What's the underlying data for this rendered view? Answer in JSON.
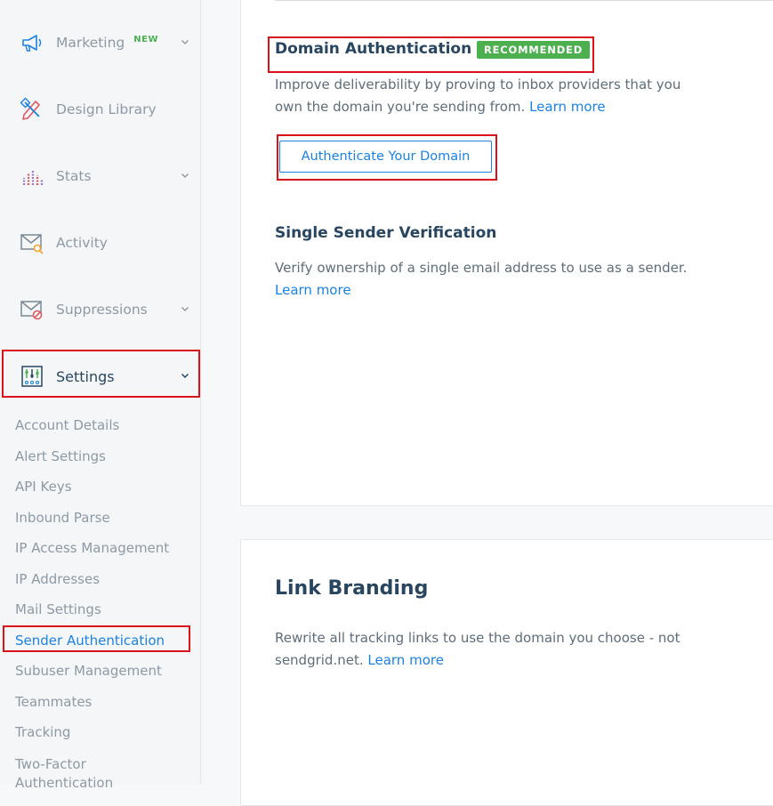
{
  "sidebar": {
    "items": [
      {
        "label": "Marketing",
        "badge": "NEW",
        "icon": "megaphone-icon"
      },
      {
        "label": "Design Library",
        "icon": "design-tools-icon"
      },
      {
        "label": "Stats",
        "icon": "bar-chart-icon"
      },
      {
        "label": "Activity",
        "icon": "envelope-search-icon"
      },
      {
        "label": "Suppressions",
        "icon": "envelope-blocked-icon"
      },
      {
        "label": "Settings",
        "icon": "sliders-icon"
      }
    ],
    "settings_sub": [
      "Account Details",
      "Alert Settings",
      "API Keys",
      "Inbound Parse",
      "IP Access Management",
      "IP Addresses",
      "Mail Settings",
      "Sender Authentication",
      "Subuser Management",
      "Teammates",
      "Tracking",
      "Two-Factor Authentication"
    ],
    "active_sub": "Sender Authentication"
  },
  "main": {
    "domain_auth": {
      "title": "Domain Authentication",
      "badge": "RECOMMENDED",
      "description": "Improve deliverability by proving to inbox providers that you own the domain you're sending from.",
      "link": "Learn more",
      "button": "Authenticate Your Domain"
    },
    "single_sender": {
      "title": "Single Sender Verification",
      "description": "Verify ownership of a single email address to use as a sender.",
      "link": "Learn more"
    },
    "link_branding": {
      "title": "Link Branding",
      "description": "Rewrite all tracking links to use the domain you choose - not sendgrid.net.",
      "link": "Learn more"
    }
  },
  "colors": {
    "accent": "#1a82e2",
    "badge_green": "#4cb04f",
    "highlight_red": "#d9121b",
    "heading": "#294661"
  }
}
